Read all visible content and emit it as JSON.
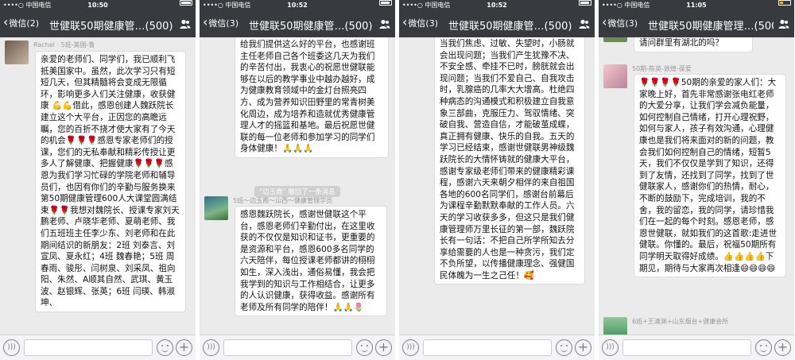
{
  "panels": [
    {
      "status": {
        "carrier": "••••○ 中国电信",
        "time": "10:50",
        "battery_level": 0.9
      },
      "nav": {
        "back_label": "微信(2)",
        "title": "世健联50期健康管…(500)"
      },
      "messages": [
        {
          "sender": "Rachel · 5班-美国-鲁",
          "text": "亲爱的老师们、同学们，我已顺利飞抵美国家中。虽然，此次学习只有短短几天，但其精髓将会变成无限循环，影响更多人们关注健康，收获健康 💪💪借此，感恩创建人魏跃院长建立这个大平台，正因您的高瞻远瞩，您的百折不挠才使大家有了今天的机会🌹🌹🌹感恩专家老师们的授课，您们的无私奉献和精彩传授让更多人了解健康、把握健康🌹🌹🌹感恩为我们学习忙碌的学院老师和辅导员们，也因有你们的辛勤与服务换来第50期健康管理600人大课堂圆满结束🌹🌹我想对魏院长、授课专家刘天鹏老师、卢晓华老师、夏萌老师、我们五班班主任李少东、刘老师和在此期间结识的新朋友：2班 刘泰言、刘宣凤、夏永红；4班 魏春艳；5班 周春雨、骏彤、闫树泉、刘采凤、祖向阳、朱然、A顺其自然、武琪、黄玉波、赵银辉、张英；6班 闫瑛、韩淑坤、"
        }
      ]
    },
    {
      "status": {
        "carrier": "••••○ 中国电信",
        "time": "10:52",
        "battery_level": 0.85
      },
      "nav": {
        "back_label": "微信(3)",
        "title": "世健联50期健康管…(500)"
      },
      "messages": [
        {
          "sender": "",
          "text": "给我们提供这么好的平台，也感谢班主任老师自己各个班委这几天为我们的辛苦付出，我衷心的祝愿世健联能够在以后的教学事业中越办越好，成为健康教育领域中的金灯台照亮四方、成为营养知识田野里的常青树美化周边，成为培养和造就优秀健康管理人才的摇篮和基地。最后祝愿世健联的每一位老师和参加学习的同学们身体健康！🙏🙏🙏"
        },
        {
          "sender": "5班～边玉霞～山西～健康管理学员",
          "text": "感恩魏跃院长，感谢世健联这个平台，感恩老师们辛勤付出，在这里收获的不仅仅是知识和证书，更重要的是资源和平台，感恩600多名同学的六天陪伴，每位授课老师都讲的栩栩如生，深入浅出，通俗易懂，我会把我学到的知识与工作相结合，让更多的人认识健康，获得收益。感谢所有老师及所有同学的陪伴！🙏🙏🌷"
        }
      ],
      "system_notice": "\"边玉霞\" 撤回了一条消息"
    },
    {
      "status": {
        "carrier": "••••○ 中国电信",
        "time": "10:52",
        "battery_level": 0.85
      },
      "nav": {
        "back_label": "微信(3)",
        "title": "世健联50期健康管…(500)"
      },
      "messages": [
        {
          "sender": "",
          "text": "当我们焦虑、过敏、失望时，小肠就会出现问题；当我们产生犹豫不决、不安全感、牵挂不已时，膀胱就会出现问题；当我们不爱自己、自我攻击时，乳腺癌的几率大大增高。杜绝四种病态的沟通模式和积极建立自我意象三部曲，克服压力、驾驭情绪、突破自我、营造自信，才能破茧成蝶，真正拥有健康、快乐的自我。五天的学习已经结束，感谢世健联男神级魏跃院长的大情怀铸就的健康大平台，感谢专家级老师们带来的健康精彩课程，感谢六天来朝夕相伴的来自祖国各地的600名同学们，感谢台前幕后为课程辛勤默默奉献的工作人员。六天的学习收获多多，但这只是我们健康管理师万里长征的第一部，魏跃院长有一句话：不把自己所学所知去分享给需要的人也是一种贪污，我们定不负所望，以传播健康理念、强健国民体魄为一生之己任！🥰"
        }
      ]
    },
    {
      "status": {
        "carrier": "••••○ 中国电信",
        "time": "11:05",
        "battery_level": 0.25
      },
      "nav": {
        "back_label": "微信(3)",
        "title": "世健联50期健康管理…(500)"
      },
      "messages": [
        {
          "sender": "",
          "text": "请问群里有湖北的吗？"
        },
        {
          "sender": "50期-陈英-敦煌-葆爱",
          "text": "🌹🌹🌹🌹50期的亲爱的家人们：大家晚上好，首先非常感谢张电红老师的大爱分享，让我们学会减负能量，如何控制自己情绪，打开心理祝野，如何与家人，孩子有效沟通，心理健康也是我们将来面对的新的问题，教会我们如何控制自己的情绪，短暂5天，我们不仅仅是学到了知识，还得到了友情，还找到了同学，找到了世健联家人，感谢你们的热情，耐心，不断的鼓励下，完成培训，我的不舍，我的留恋，我的同学，请珍惜我们在一起的每个时刻。感恩老师，感恩世健联，就如我们的这首歌:走进世健联。你懂的。最后，祝福50期所有同学明天取得好成绩。👍👍👍👍下期见，期待与大家再次相逢😄😄😄😄"
        },
        {
          "sender": "6班+王清渊+山东烟台+健康会所",
          "text": ""
        }
      ]
    }
  ],
  "input": {
    "voice_icon": "voice-icon",
    "emoji_icon": "emoji-icon",
    "plus_icon": "plus-icon"
  },
  "colors": {
    "navbar": "#393a3f",
    "chat_bg": "#ebebeb",
    "bubble": "#ffffff"
  }
}
